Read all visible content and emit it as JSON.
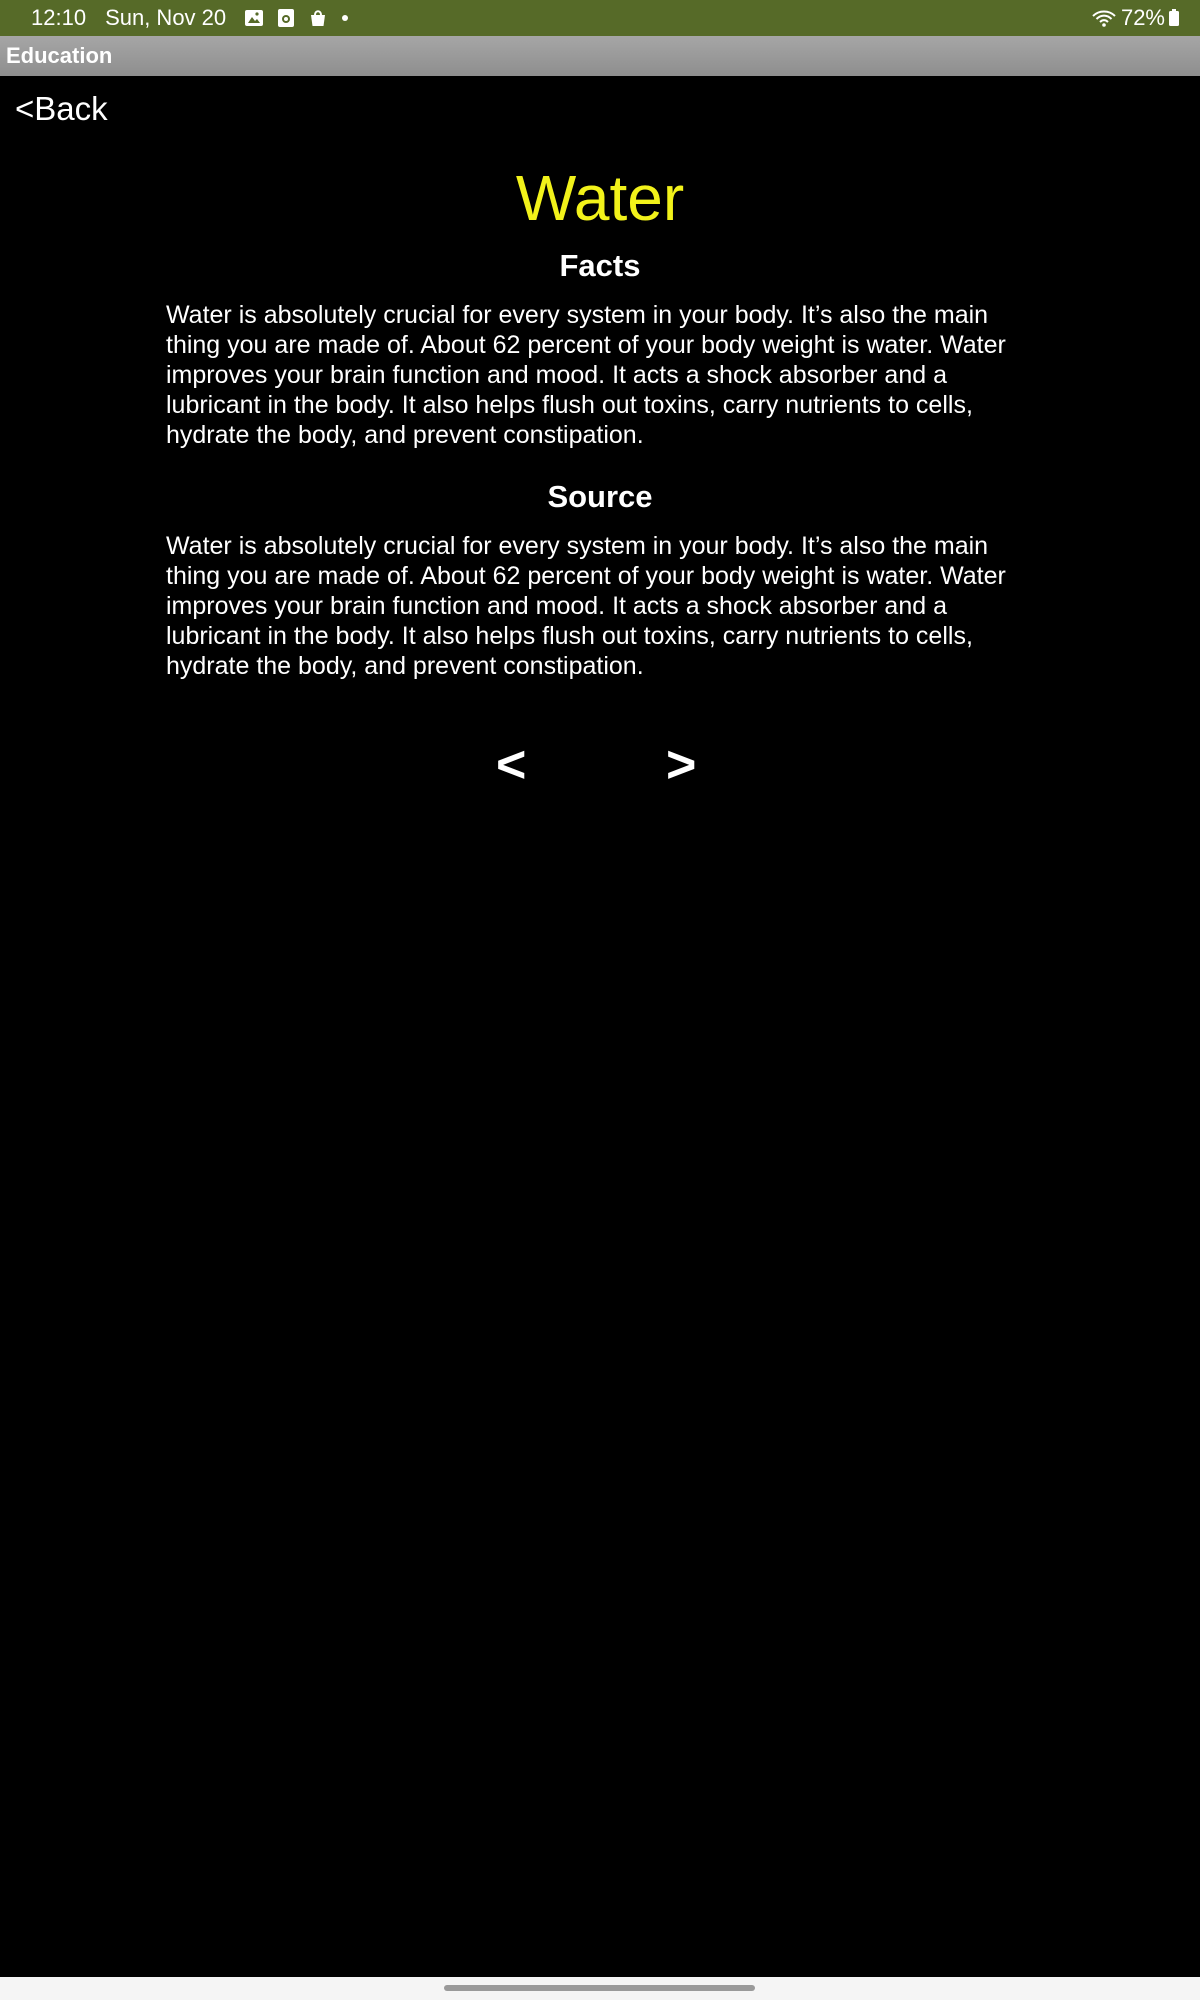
{
  "status_bar": {
    "time": "12:10",
    "date": "Sun, Nov 20",
    "battery": "72%",
    "notification_icons": [
      "gallery-icon",
      "camera-icon",
      "shopping-bag-icon"
    ],
    "color": "#566a28"
  },
  "app_bar": {
    "title": "Education"
  },
  "nav": {
    "back_label": "<Back",
    "prev_label": "<",
    "next_label": ">"
  },
  "page": {
    "title": "Water",
    "title_color": "#f2f21a",
    "sections": [
      {
        "heading": "Facts",
        "text": "Water is absolutely crucial for every system in your body. It’s also the main thing you are made of. About 62 percent of your body weight is water. Water improves your brain function and mood. It acts a shock absorber and a  lubricant in the body. It also helps flush out toxins, carry nutrients to cells, hydrate the body, and prevent constipation."
      },
      {
        "heading": "Source",
        "text": "Water is absolutely crucial for every system in your body. It’s also the main thing you are made of. About 62 percent of your body weight is water. Water improves your brain function and mood. It acts a shock absorber and a  lubricant in the body. It also helps flush out toxins, carry nutrients to cells, hydrate the body, and prevent constipation."
      }
    ]
  }
}
